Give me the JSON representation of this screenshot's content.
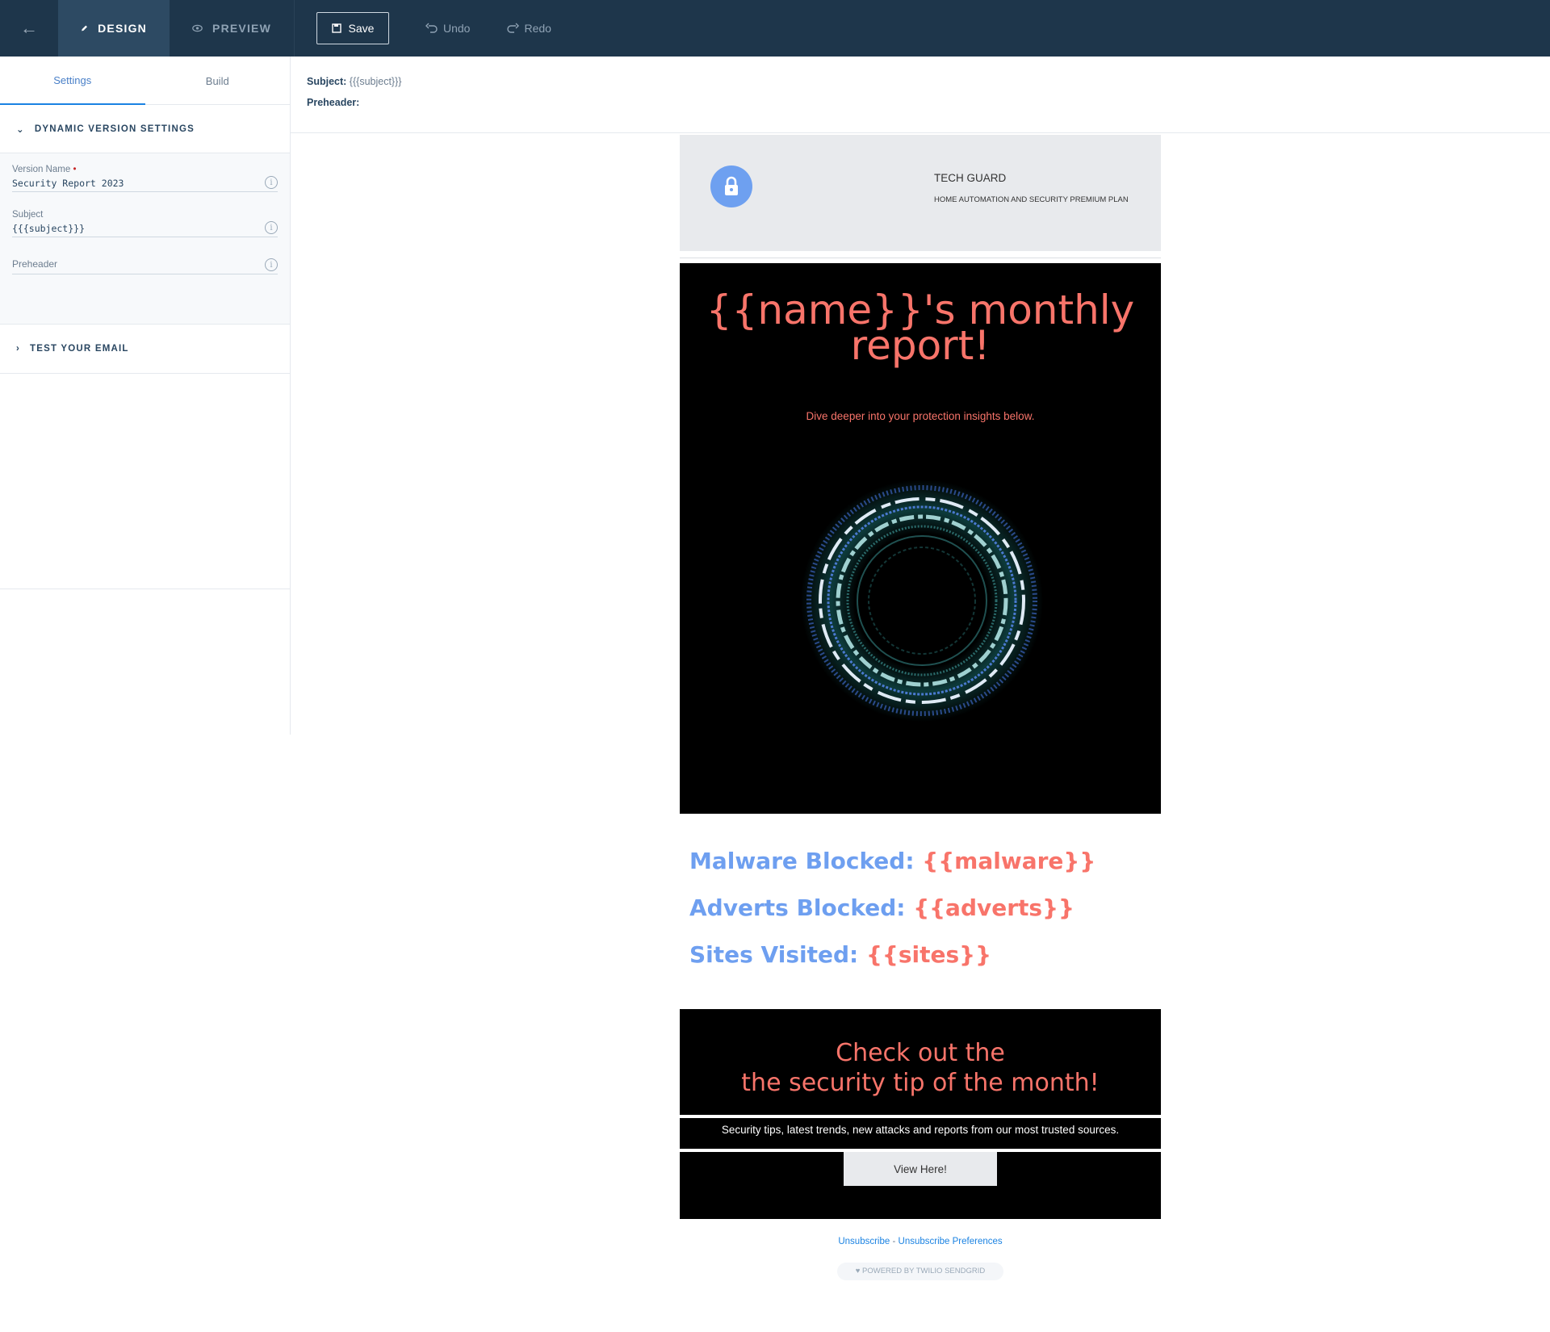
{
  "topbar": {
    "back_icon": "arrow-left-icon",
    "design_label": "DESIGN",
    "preview_label": "PREVIEW",
    "save_label": "Save",
    "undo_label": "Undo",
    "redo_label": "Redo"
  },
  "sidebar": {
    "tabs": [
      {
        "label": "Settings",
        "active": true
      },
      {
        "label": "Build",
        "active": false
      }
    ],
    "dynamic_section": "DYNAMIC VERSION SETTINGS",
    "fields": {
      "version_name_label": "Version Name",
      "version_name_value": "Security Report 2023",
      "subject_label": "Subject",
      "subject_value": "{{{subject}}}",
      "preheader_label": "Preheader"
    },
    "test_section": "TEST YOUR EMAIL"
  },
  "subject_bar": {
    "subject_label": "Subject:",
    "subject_value": "{{{subject}}}",
    "preheader_label": "Preheader:"
  },
  "email": {
    "brand": "TECH GUARD",
    "plan": "HOME AUTOMATION AND SECURITY PREMIUM PLAN",
    "hero_title": "{{name}}'s monthly report!",
    "hero_subtitle": "Dive deeper into your protection insights below.",
    "stats": [
      {
        "label": "Malware Blocked:",
        "value": "{{malware}}"
      },
      {
        "label": "Adverts Blocked:",
        "value": "{{adverts}}"
      },
      {
        "label": "Sites Visited:",
        "value": "{{sites}}"
      }
    ],
    "tip_line1": "Check out the",
    "tip_line2": "the security tip of the month!",
    "tip_desc": "Security tips, latest trends, new attacks and reports from our most trusted sources.",
    "cta": "View Here!",
    "unsubscribe": "Unsubscribe",
    "separator": " - ",
    "unsubscribe_prefs": "Unsubscribe Preferences",
    "powered": "♥ POWERED BY TWILIO SENDGRID"
  },
  "colors": {
    "topbar": "#1e364b",
    "accent_blue": "#6e9ff0",
    "accent_coral": "#f8746a"
  }
}
